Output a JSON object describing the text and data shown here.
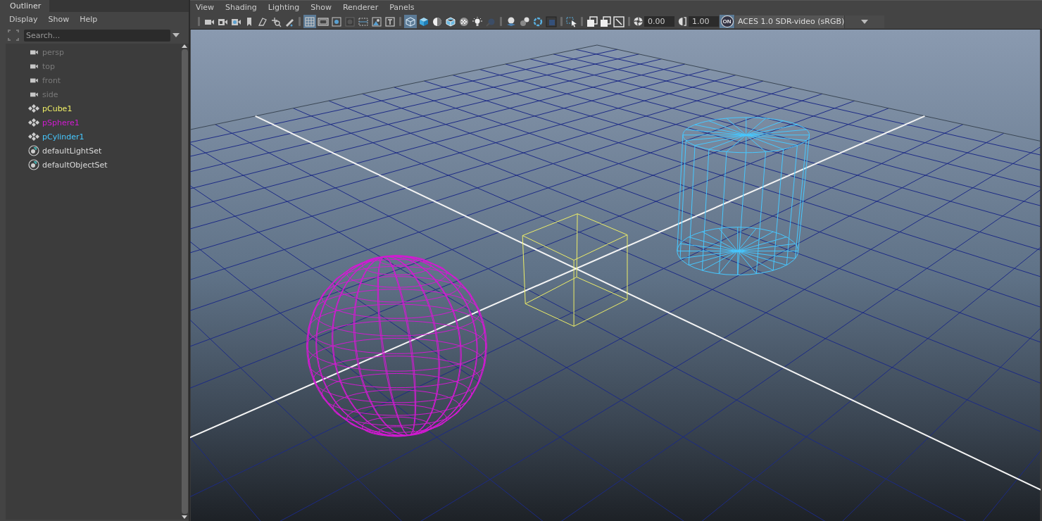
{
  "outliner": {
    "tab": "Outliner",
    "menu": [
      "Display",
      "Show",
      "Help"
    ],
    "search": {
      "placeholder": "Search..."
    },
    "items": [
      {
        "kind": "camera",
        "label": "persp",
        "hidden": true
      },
      {
        "kind": "camera",
        "label": "top",
        "hidden": true
      },
      {
        "kind": "camera",
        "label": "front",
        "hidden": true
      },
      {
        "kind": "camera",
        "label": "side",
        "hidden": true
      },
      {
        "kind": "transform",
        "label": "pCube1",
        "hidden": false,
        "color": "#eeee66"
      },
      {
        "kind": "transform",
        "label": "pSphere1",
        "hidden": false,
        "color": "#d21ad2"
      },
      {
        "kind": "transform",
        "label": "pCylinder1",
        "hidden": false,
        "color": "#46c8ff"
      },
      {
        "kind": "set",
        "label": "defaultLightSet",
        "hidden": false
      },
      {
        "kind": "set",
        "label": "defaultObjectSet",
        "hidden": false
      }
    ]
  },
  "viewport": {
    "menu": [
      "View",
      "Shading",
      "Lighting",
      "Show",
      "Renderer",
      "Panels"
    ],
    "toolbar": {
      "groups": [
        [
          {
            "selected": false
          },
          {
            "selected": false
          },
          {
            "selected": false
          },
          {
            "selected": false
          },
          {
            "selected": false
          },
          {
            "selected": false
          },
          {
            "selected": false
          }
        ],
        [
          {
            "selected": true
          },
          {
            "selected": false
          },
          {
            "selected": false
          },
          {
            "selected": false
          },
          {
            "selected": false
          },
          {
            "selected": false
          },
          {
            "selected": false
          }
        ],
        [
          {
            "selected": true
          },
          {
            "selected": false
          },
          {
            "selected": false
          },
          {
            "selected": false
          },
          {
            "selected": false
          },
          {
            "selected": false
          },
          {
            "selected": false
          }
        ],
        [
          {
            "selected": false
          },
          {
            "selected": false
          },
          {
            "selected": false
          },
          {
            "selected": false
          }
        ],
        [
          {
            "selected": false
          }
        ],
        [
          {
            "selected": false
          },
          {
            "selected": false
          },
          {
            "selected": false
          }
        ]
      ]
    },
    "exposure": "0.00",
    "gamma": "1.00",
    "view_transform_toggle": {
      "label": "ON",
      "on": true
    },
    "color_space": "ACES 1.0 SDR-video (sRGB)"
  }
}
